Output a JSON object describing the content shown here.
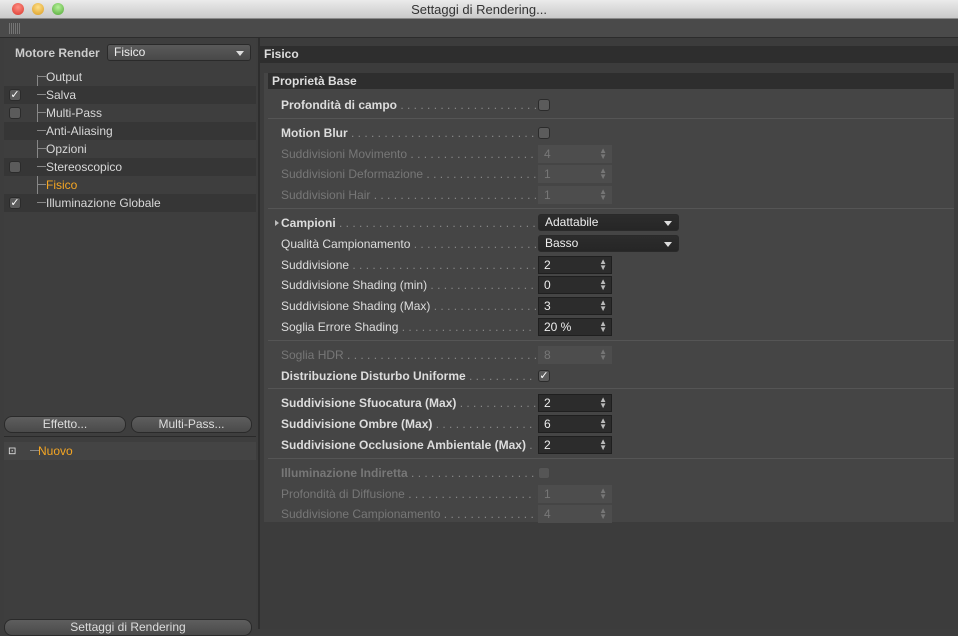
{
  "window": {
    "title": "Settaggi di Rendering..."
  },
  "left": {
    "renderer_label": "Motore Render",
    "renderer_value": "Fisico",
    "items": [
      {
        "label": "Output",
        "check": "none",
        "active": false
      },
      {
        "label": "Salva",
        "check": "checked",
        "active": false
      },
      {
        "label": "Multi-Pass",
        "check": "unchecked",
        "active": false
      },
      {
        "label": "Anti-Aliasing",
        "check": "none",
        "active": false
      },
      {
        "label": "Opzioni",
        "check": "none",
        "active": false
      },
      {
        "label": "Stereoscopico",
        "check": "unchecked",
        "active": false
      },
      {
        "label": "Fisico",
        "check": "none",
        "active": true
      },
      {
        "label": "Illuminazione Globale",
        "check": "checked",
        "active": false
      }
    ],
    "effect_button": "Effetto...",
    "multipass_button": "Multi-Pass...",
    "preset": "Nuovo",
    "bottom_button": "Settaggi di Rendering"
  },
  "right": {
    "header": "Fisico",
    "group": "Proprietà Base",
    "rows": [
      {
        "label": "Profondità di campo",
        "type": "checkbox",
        "value": "",
        "checked": false,
        "bold": true,
        "disabled": false
      },
      {
        "sep": true
      },
      {
        "label": "Motion Blur",
        "type": "checkbox",
        "value": "",
        "checked": false,
        "bold": true,
        "disabled": false
      },
      {
        "label": "Suddivisioni Movimento",
        "type": "number",
        "value": "4",
        "bold": false,
        "disabled": true
      },
      {
        "label": "Suddivisioni Deformazione",
        "type": "number",
        "value": "1",
        "bold": false,
        "disabled": true
      },
      {
        "label": "Suddivisioni Hair",
        "type": "number",
        "value": "1",
        "bold": false,
        "disabled": true
      },
      {
        "sep": true
      },
      {
        "label": "Campioni",
        "type": "dropdown",
        "value": "Adattabile",
        "bold": true,
        "disabled": false,
        "expander": true
      },
      {
        "label": "Qualità Campionamento",
        "type": "dropdown",
        "value": "Basso",
        "bold": false,
        "disabled": false
      },
      {
        "label": "Suddivisione",
        "type": "number",
        "value": "2",
        "bold": false,
        "disabled": false
      },
      {
        "label": "Suddivisione Shading (min)",
        "type": "number",
        "value": "0",
        "bold": false,
        "disabled": false
      },
      {
        "label": "Suddivisione Shading (Max)",
        "type": "number",
        "value": "3",
        "bold": false,
        "disabled": false
      },
      {
        "label": "Soglia Errore Shading",
        "type": "number",
        "value": "20 %",
        "bold": false,
        "disabled": false
      },
      {
        "sep": true
      },
      {
        "label": "Soglia HDR",
        "type": "number",
        "value": "8",
        "bold": false,
        "disabled": true
      },
      {
        "label": "Distribuzione Disturbo Uniforme",
        "type": "checkbox",
        "value": "",
        "checked": true,
        "bold": true,
        "disabled": false
      },
      {
        "sep": true
      },
      {
        "label": "Suddivisione Sfuocatura (Max)",
        "type": "number",
        "value": "2",
        "bold": true,
        "disabled": false
      },
      {
        "label": "Suddivisione Ombre (Max)",
        "type": "number",
        "value": "6",
        "bold": true,
        "disabled": false
      },
      {
        "label": "Suddivisione Occlusione Ambientale (Max)",
        "type": "number",
        "value": "2",
        "bold": true,
        "disabled": false
      },
      {
        "sep": true
      },
      {
        "label": "Illuminazione Indiretta",
        "type": "checkbox",
        "value": "",
        "checked": false,
        "bold": true,
        "disabled": true
      },
      {
        "label": "Profondità di Diffusione",
        "type": "number",
        "value": "1",
        "bold": false,
        "disabled": true
      },
      {
        "label": "Suddivisione Campionamento",
        "type": "number",
        "value": "4",
        "bold": false,
        "disabled": true
      }
    ]
  },
  "colors": {
    "active": "#f5a623"
  }
}
